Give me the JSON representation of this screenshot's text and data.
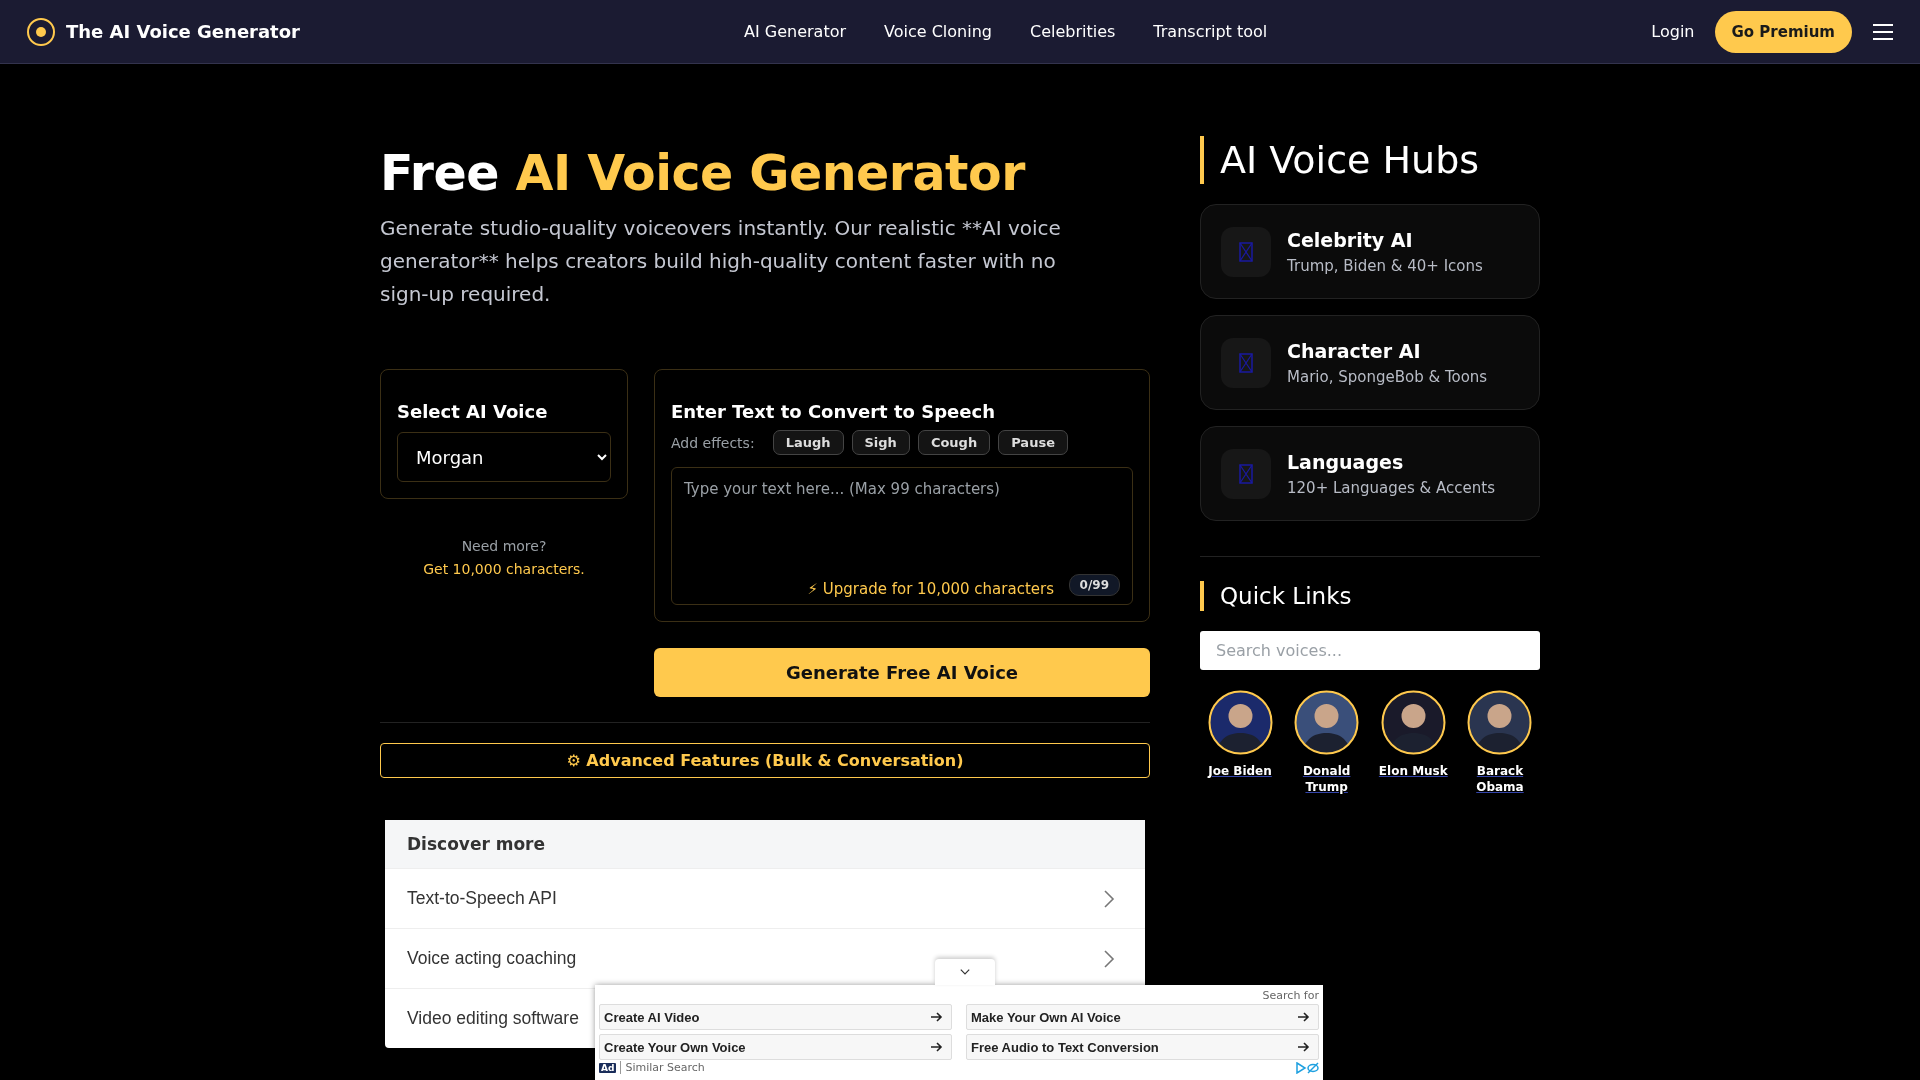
{
  "nav": {
    "brand": "The AI Voice Generator",
    "links": [
      "AI Generator",
      "Voice Cloning",
      "Celebrities",
      "Transcript tool"
    ],
    "login": "Login",
    "premium": "Go Premium"
  },
  "hero": {
    "title_plain": "Free",
    "title_accent": "AI Voice Generator",
    "subtitle": "Generate studio-quality voiceovers instantly. Our realistic **AI voice generator** helps creators build high-quality content faster with no sign-up required."
  },
  "voice_card": {
    "heading": "Select AI Voice",
    "value": "Morgan",
    "note": "Need more?",
    "note_link": "Get 10,000 characters."
  },
  "text_card": {
    "heading": "Enter Text to Convert to Speech",
    "effects_label": "Add effects:",
    "effects": [
      "Laugh",
      "Sigh",
      "Cough",
      "Pause"
    ],
    "placeholder": "Type your text here... (Max 99 characters)",
    "upgrade": "⚡ Upgrade for 10,000 characters",
    "counter": "0/99"
  },
  "generate_button": "Generate Free AI Voice",
  "advanced_button": "⚙ Advanced Features (Bulk & Conversation)",
  "discover": {
    "heading": "Discover more",
    "items": [
      "Text-to-Speech API",
      "Voice acting coaching",
      "Video editing software"
    ]
  },
  "ad": {
    "search_for": "Search for",
    "links": [
      "Create AI Video",
      "Make Your Own AI Voice",
      "Create Your Own Voice",
      "Free Audio to Text Conversion"
    ],
    "badge": "Ad",
    "label": "Similar Search"
  },
  "hubs": {
    "heading": "AI Voice Hubs",
    "items": [
      {
        "title": "Celebrity AI",
        "subtitle": "Trump, Biden & 40+ Icons"
      },
      {
        "title": "Character AI",
        "subtitle": "Mario, SpongeBob & Toons"
      },
      {
        "title": "Languages",
        "subtitle": "120+ Languages & Accents"
      }
    ]
  },
  "quick_links": {
    "heading": "Quick Links",
    "placeholder": "Search voices...",
    "people": [
      "Joe Biden",
      "Donald Trump",
      "Elon Musk",
      "Barack Obama"
    ]
  }
}
